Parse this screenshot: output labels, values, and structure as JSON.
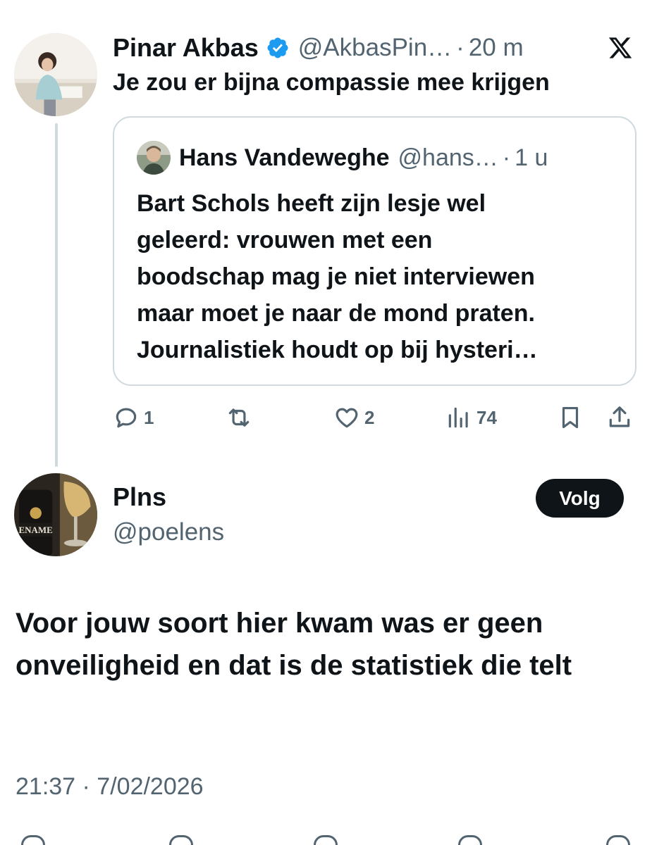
{
  "quoting_tweet": {
    "author_name": "Pinar Akbas",
    "handle": "@AkbasPin…",
    "separator": "·",
    "time": "20 m",
    "text": "Je zou er bijna compassie mee krijgen"
  },
  "quoted_tweet": {
    "author_name": "Hans Vandeweghe",
    "handle": "@hans…",
    "separator": "·",
    "time": "1 u",
    "text": "Bart Schols heeft zijn lesje wel\ngeleerd: vrouwen met een\nboodschap mag je niet interviewen\nmaar moet je naar de mond praten.\nJournalistiek houdt op bij hysteri…"
  },
  "actions": {
    "replies": "1",
    "likes": "2",
    "views": "74"
  },
  "reply_author": {
    "name": "Plns",
    "handle": "@poelens",
    "follow_label": "Volg",
    "avatar_text": "ENAME"
  },
  "main_tweet": {
    "text": "Voor jouw soort hier kwam was er geen onveiligheid en dat is de statistiek die telt",
    "timestamp": "21:37 · 7/02/2026"
  },
  "colors": {
    "text_primary": "#0f1419",
    "text_secondary": "#536471",
    "verified_blue": "#1d9bf0",
    "border": "#cfd9de"
  },
  "icons": [
    "x-logo-icon",
    "verified-badge-icon",
    "reply-icon",
    "retweet-icon",
    "like-icon",
    "views-icon",
    "bookmark-icon",
    "share-icon"
  ]
}
